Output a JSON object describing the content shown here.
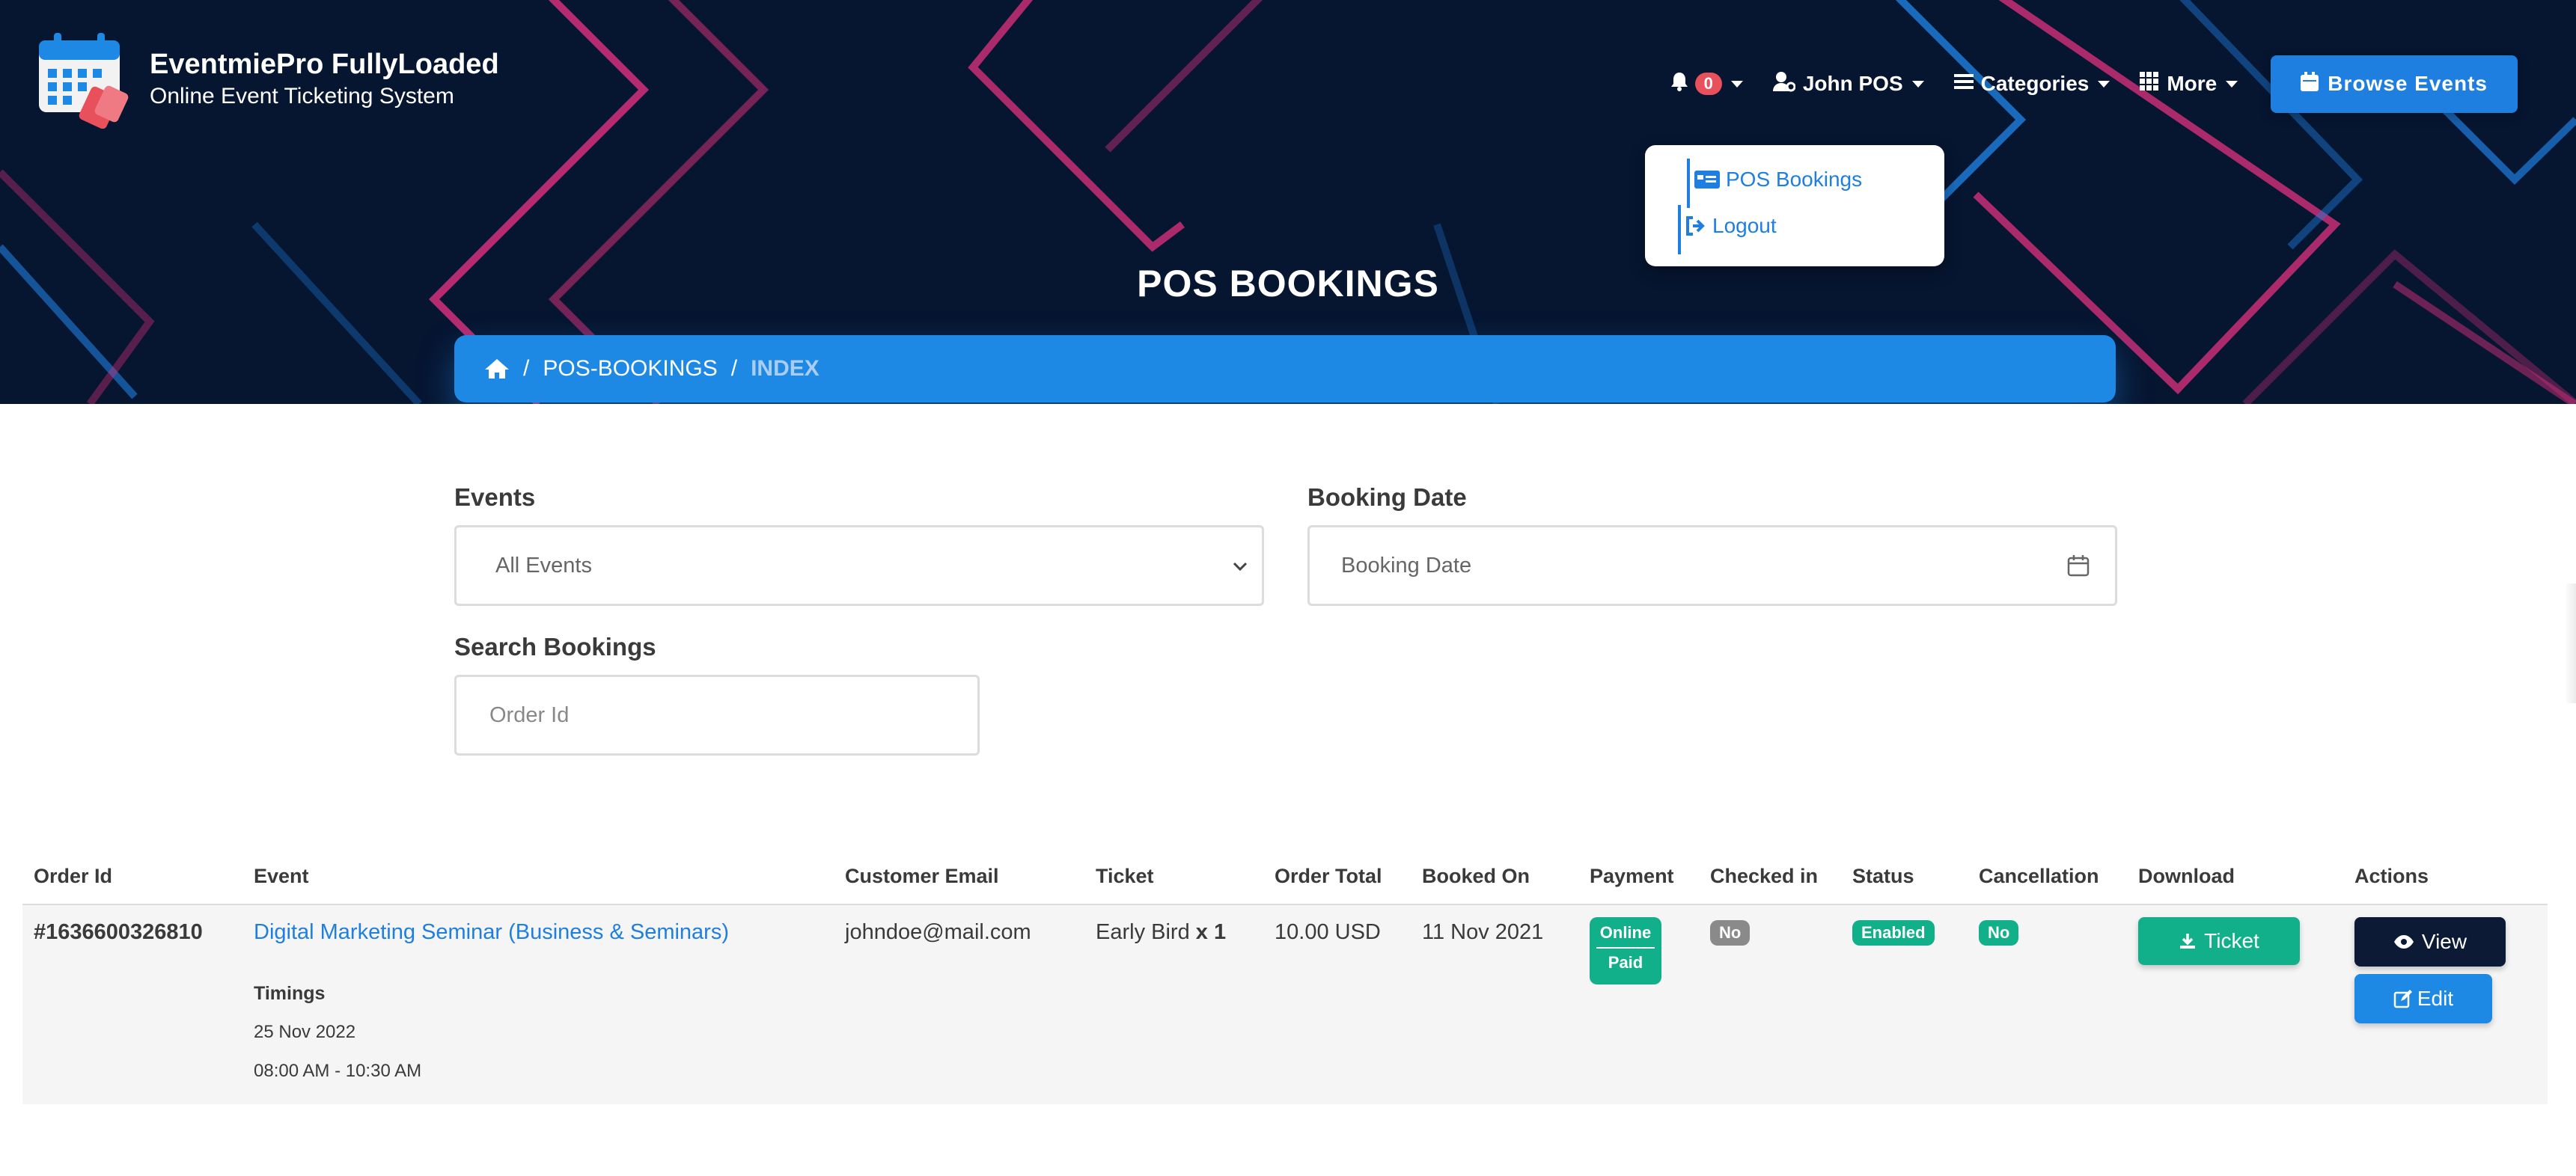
{
  "brand": {
    "title": "EventmiePro FullyLoaded",
    "subtitle": "Online Event Ticketing System"
  },
  "nav": {
    "notifications_count": "0",
    "user_name": "John POS",
    "categories_label": "Categories",
    "more_label": "More",
    "browse_label": "Browse Events"
  },
  "user_dropdown": {
    "items": [
      {
        "label": "POS Bookings"
      },
      {
        "label": "Logout"
      }
    ]
  },
  "page_title": "POS BOOKINGS",
  "breadcrumb": {
    "items": [
      "POS-BOOKINGS",
      "INDEX"
    ]
  },
  "filters": {
    "events_label": "Events",
    "events_selected": "All Events",
    "booking_date_label": "Booking Date",
    "booking_date_placeholder": "Booking Date",
    "search_label": "Search Bookings",
    "search_placeholder": "Order Id"
  },
  "table": {
    "headers": [
      "Order Id",
      "Event",
      "Customer Email",
      "Ticket",
      "Order Total",
      "Booked On",
      "Payment",
      "Checked in",
      "Status",
      "Cancellation",
      "Download",
      "Actions"
    ],
    "rows": [
      {
        "order_id": "#1636600326810",
        "event": "Digital Marketing Seminar (Business & Seminars)",
        "timings_label": "Timings",
        "timing_date": "25 Nov 2022",
        "timing_time": "08:00 AM - 10:30 AM",
        "email": "johndoe@mail.com",
        "ticket_name": "Early Bird",
        "ticket_qty": "x 1",
        "order_total": "10.00 USD",
        "booked_on": "11 Nov 2021",
        "payment_method": "Online",
        "payment_status": "Paid",
        "checked_in": "No",
        "status": "Enabled",
        "cancellation": "No",
        "download_label": "Ticket",
        "view_label": "View",
        "edit_label": "Edit"
      }
    ]
  },
  "colors": {
    "hero_bg": "#061530",
    "primary": "#1e88e5",
    "success": "#12b08a",
    "dark_button": "#0c1a35"
  }
}
